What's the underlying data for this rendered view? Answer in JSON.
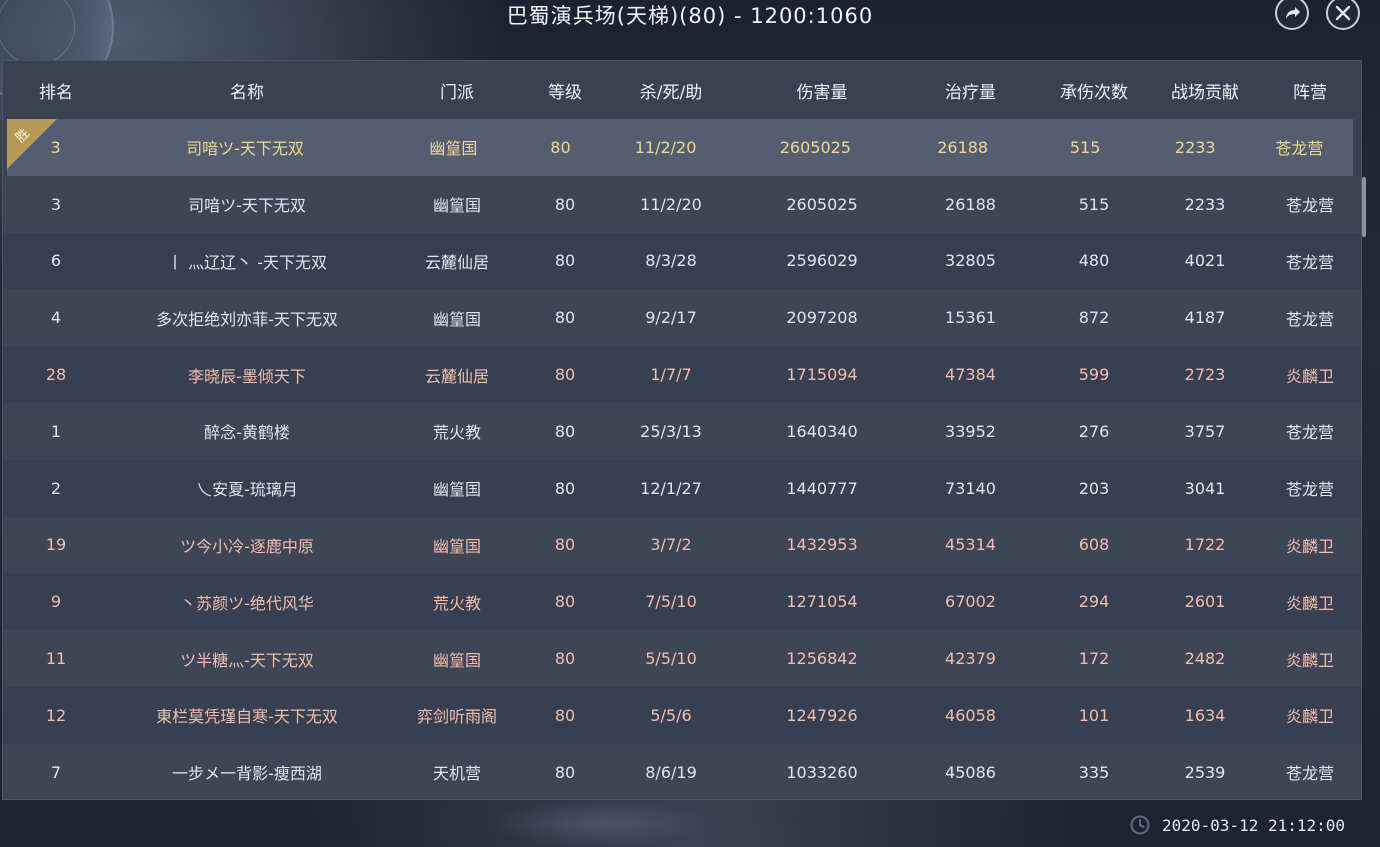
{
  "title": "巴蜀演兵场(天梯)(80) - 1200:1060",
  "colors": {
    "panel_bg": "#3a4254",
    "highlight_row": "#555e71",
    "highlight_text": "#efd88b",
    "rival_text": "#f4bcaa",
    "default_text": "#e1e5ee"
  },
  "icons": {
    "share": "share-arrow-icon",
    "close": "close-icon",
    "clock": "clock-icon"
  },
  "headers": {
    "rank": "排名",
    "name": "名称",
    "sect": "门派",
    "level": "等级",
    "kda": "杀/死/助",
    "damage": "伤害量",
    "heal": "治疗量",
    "hits": "承伤次数",
    "contrib": "战场贡献",
    "camp": "阵营"
  },
  "win_badge": "胜",
  "highlight": {
    "rank": "3",
    "name": "司喑ツ-天下无双",
    "sect": "幽篁国",
    "level": "80",
    "kda": "11/2/20",
    "damage": "2605025",
    "heal": "26188",
    "hits": "515",
    "contrib": "2233",
    "camp": "苍龙营"
  },
  "rows": [
    {
      "rank": "3",
      "name": "司喑ツ-天下无双",
      "sect": "幽篁国",
      "level": "80",
      "kda": "11/2/20",
      "damage": "2605025",
      "heal": "26188",
      "hits": "515",
      "contrib": "2233",
      "camp": "苍龙营"
    },
    {
      "rank": "6",
      "name": "丨 灬辽辽丶 -天下无双",
      "sect": "云麓仙居",
      "level": "80",
      "kda": "8/3/28",
      "damage": "2596029",
      "heal": "32805",
      "hits": "480",
      "contrib": "4021",
      "camp": "苍龙营"
    },
    {
      "rank": "4",
      "name": "多次拒绝刘亦菲-天下无双",
      "sect": "幽篁国",
      "level": "80",
      "kda": "9/2/17",
      "damage": "2097208",
      "heal": "15361",
      "hits": "872",
      "contrib": "4187",
      "camp": "苍龙营"
    },
    {
      "rank": "28",
      "name": "李晓辰-墨倾天下",
      "sect": "云麓仙居",
      "level": "80",
      "kda": "1/7/7",
      "damage": "1715094",
      "heal": "47384",
      "hits": "599",
      "contrib": "2723",
      "camp": "炎麟卫"
    },
    {
      "rank": "1",
      "name": "醉念-黄鹤楼",
      "sect": "荒火教",
      "level": "80",
      "kda": "25/3/13",
      "damage": "1640340",
      "heal": "33952",
      "hits": "276",
      "contrib": "3757",
      "camp": "苍龙营"
    },
    {
      "rank": "2",
      "name": "乀安夏-琉璃月",
      "sect": "幽篁国",
      "level": "80",
      "kda": "12/1/27",
      "damage": "1440777",
      "heal": "73140",
      "hits": "203",
      "contrib": "3041",
      "camp": "苍龙营"
    },
    {
      "rank": "19",
      "name": "ツ今小冷-逐鹿中原",
      "sect": "幽篁国",
      "level": "80",
      "kda": "3/7/2",
      "damage": "1432953",
      "heal": "45314",
      "hits": "608",
      "contrib": "1722",
      "camp": "炎麟卫"
    },
    {
      "rank": "9",
      "name": "丶苏颜ツ-绝代风华",
      "sect": "荒火教",
      "level": "80",
      "kda": "7/5/10",
      "damage": "1271054",
      "heal": "67002",
      "hits": "294",
      "contrib": "2601",
      "camp": "炎麟卫"
    },
    {
      "rank": "11",
      "name": "ツ半糖灬-天下无双",
      "sect": "幽篁国",
      "level": "80",
      "kda": "5/5/10",
      "damage": "1256842",
      "heal": "42379",
      "hits": "172",
      "contrib": "2482",
      "camp": "炎麟卫"
    },
    {
      "rank": "12",
      "name": "東栏莫凭瑾自寒-天下无双",
      "sect": "弈剑听雨阁",
      "level": "80",
      "kda": "5/5/6",
      "damage": "1247926",
      "heal": "46058",
      "hits": "101",
      "contrib": "1634",
      "camp": "炎麟卫"
    },
    {
      "rank": "7",
      "name": "一步メ一背影-瘦西湖",
      "sect": "天机营",
      "level": "80",
      "kda": "8/6/19",
      "damage": "1033260",
      "heal": "45086",
      "hits": "335",
      "contrib": "2539",
      "camp": "苍龙营"
    }
  ],
  "timestamp": "2020-03-12 21:12:00"
}
